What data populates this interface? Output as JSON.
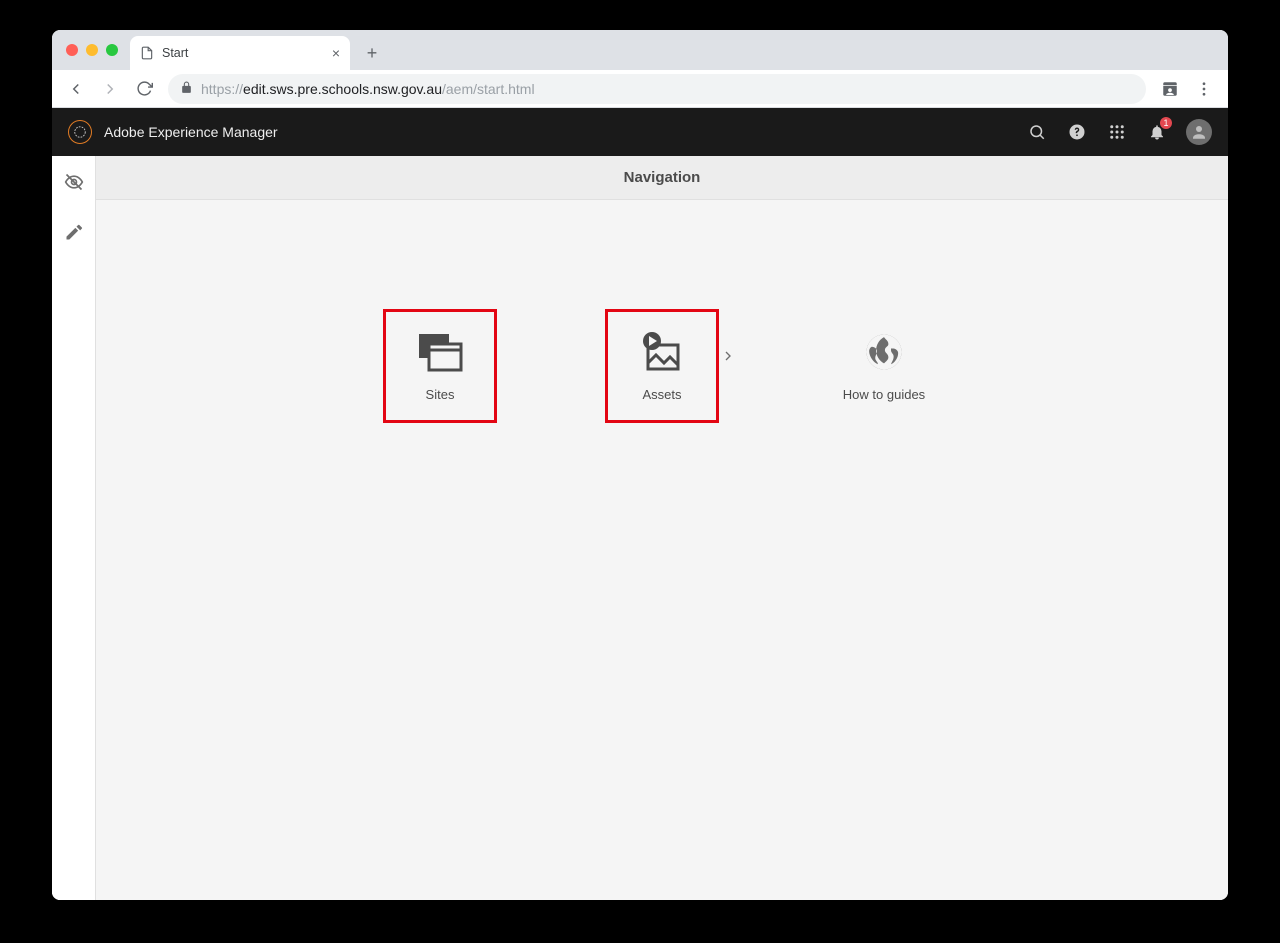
{
  "browser": {
    "tab_title": "Start",
    "url_prefix": "https://",
    "url_host": "edit.sws.pre.schools.nsw.gov.au",
    "url_path": "/aem/start.html",
    "new_tab_symbol": "+",
    "close_symbol": "×"
  },
  "aem": {
    "product_name": "Adobe Experience Manager",
    "nav_heading": "Navigation",
    "notification_count": "1",
    "cards": [
      {
        "label": "Sites",
        "highlight": true,
        "icon": "sites",
        "has_children": false
      },
      {
        "label": "Assets",
        "highlight": true,
        "icon": "assets",
        "has_children": true
      },
      {
        "label": "How to guides",
        "highlight": false,
        "icon": "globe",
        "has_children": false
      }
    ]
  }
}
